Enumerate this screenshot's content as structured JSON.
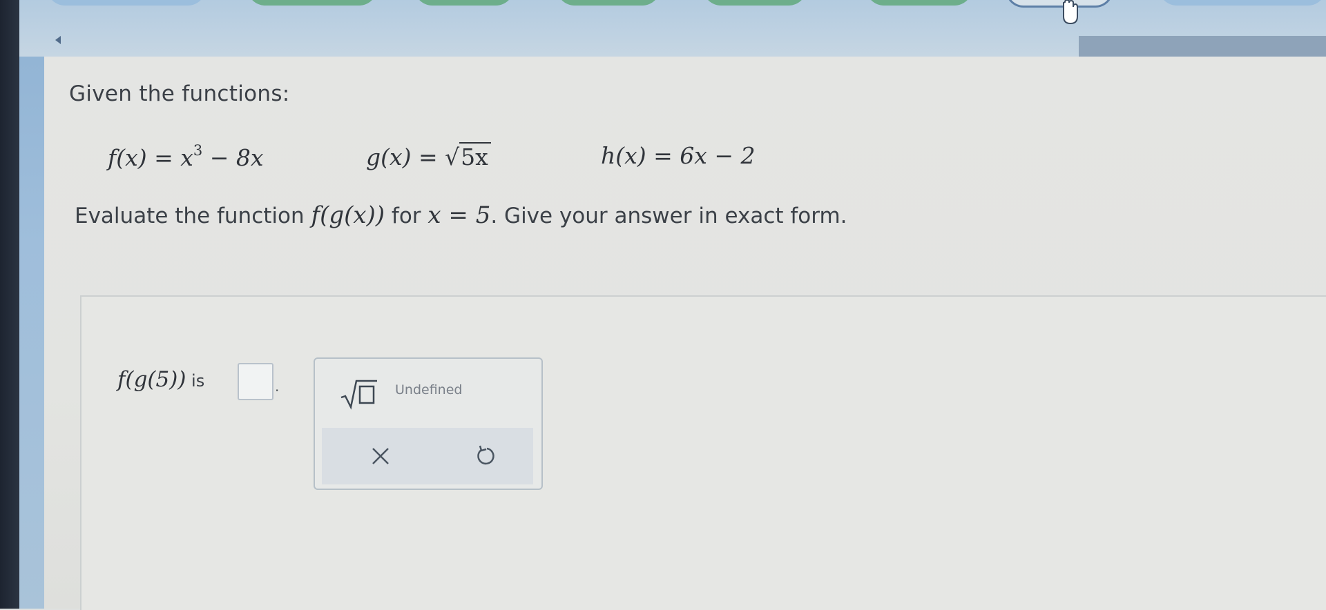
{
  "question": {
    "heading": "Given the functions:",
    "functions": {
      "f": {
        "lhs": "f(x) = x",
        "exp": "3",
        "rest": " − 8x"
      },
      "g": {
        "lhs": "g(x) = ",
        "radicand": "5x"
      },
      "h": {
        "text": "h(x) = 6x − 2"
      }
    },
    "prompt": {
      "before": "Evaluate the function ",
      "expr": "f(g(x))",
      "mid": " for ",
      "cond": "x = 5",
      "after": ". Give your answer in exact form."
    }
  },
  "answer": {
    "label_expr": "f(g(5))",
    "label_is": " is",
    "value": "",
    "period": "."
  },
  "keypad": {
    "undefined_label": "Undefined",
    "sqrt_icon": "square-root-icon",
    "clear_icon": "close-icon",
    "undo_icon": "undo-icon"
  },
  "colors": {
    "accent_green": "#6dae8b",
    "accent_blue": "#9bbedd",
    "progress": "#8ea3b9"
  }
}
